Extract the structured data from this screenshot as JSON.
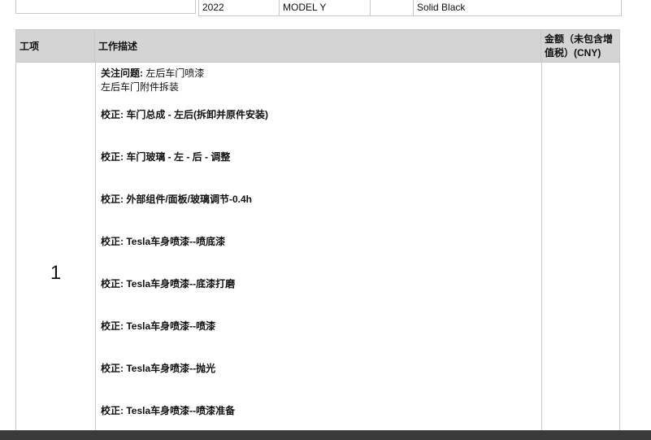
{
  "vehicle": {
    "year": "2022",
    "model": "MODEL Y",
    "trim": "",
    "color": "Solid Black"
  },
  "table": {
    "headers": {
      "item": "工项",
      "description": "工作描述",
      "amount": "金额（未包含增值税）(CNY)"
    },
    "rows": [
      {
        "item_number": "1",
        "issue_label": "关注问题:",
        "issue_text": "左后车门喷漆",
        "sub_text": "左后车门附件拆装",
        "corrections": [
          "校正: 车门总成 - 左后(拆卸并原件安装)",
          "校正: 车门玻璃 - 左 - 后 - 调整",
          "校正: 外部组件/面板/玻璃调节-0.4h",
          "校正: Tesla车身喷漆--喷底漆",
          "校正: Tesla车身喷漆--底漆打磨",
          "校正: Tesla车身喷漆--喷漆",
          "校正: Tesla车身喷漆--抛光",
          "校正: Tesla车身喷漆--喷漆准备"
        ]
      }
    ]
  }
}
